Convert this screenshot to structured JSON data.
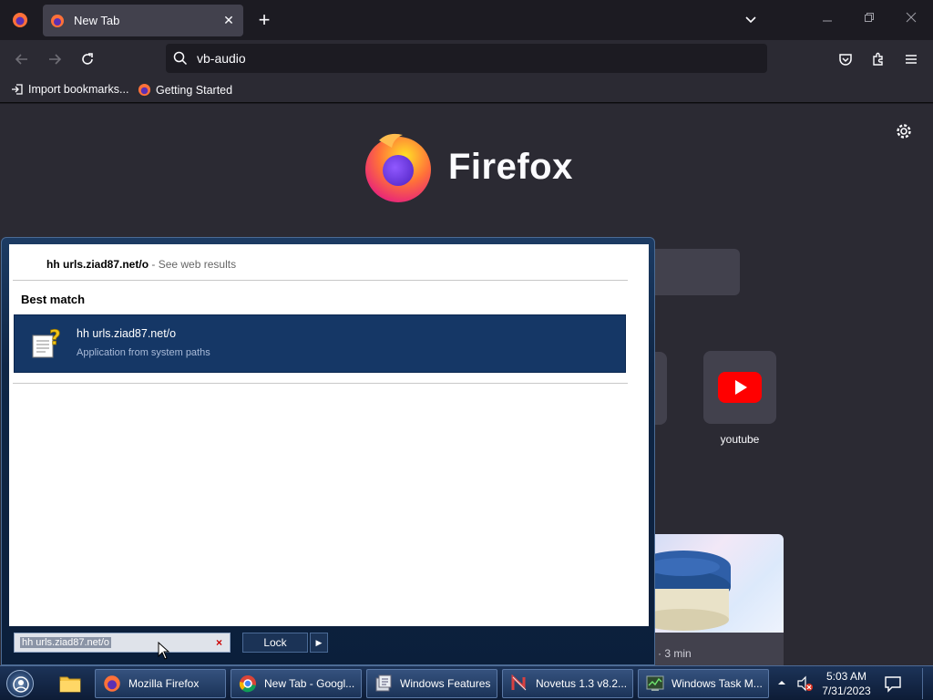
{
  "browser": {
    "tab": {
      "title": "New Tab",
      "close": "✕"
    },
    "new_tab": "+",
    "address": {
      "value": "vb-audio"
    },
    "bookmarks": [
      {
        "label": "Import bookmarks..."
      },
      {
        "label": "Getting Started"
      }
    ],
    "brand": "Firefox",
    "top_site": {
      "label": "youtube"
    },
    "story": {
      "meta": "· 3 min"
    },
    "colors": {
      "accent": "#ff7139",
      "page": "#2b2a33",
      "youtube": "#ff0000"
    }
  },
  "start_menu": {
    "web_query": "hh urls.ziad87.net/o",
    "web_hint": " - See web results",
    "best_match_heading": "Best match",
    "result": {
      "title": "hh urls.ziad87.net/o",
      "subtitle": "Application from system paths"
    },
    "search_value": "hh urls.ziad87.net/o",
    "clear": "×",
    "lock_label": "Lock",
    "arrow": "▶"
  },
  "taskbar": {
    "items": [
      {
        "label": "Mozilla Firefox"
      },
      {
        "label": "New Tab - Googl..."
      },
      {
        "label": "Windows Features"
      },
      {
        "label": "Novetus 1.3 v8.2..."
      },
      {
        "label": "Windows Task M..."
      }
    ],
    "clock": {
      "time": "5:03 AM",
      "date": "7/31/2023"
    }
  }
}
